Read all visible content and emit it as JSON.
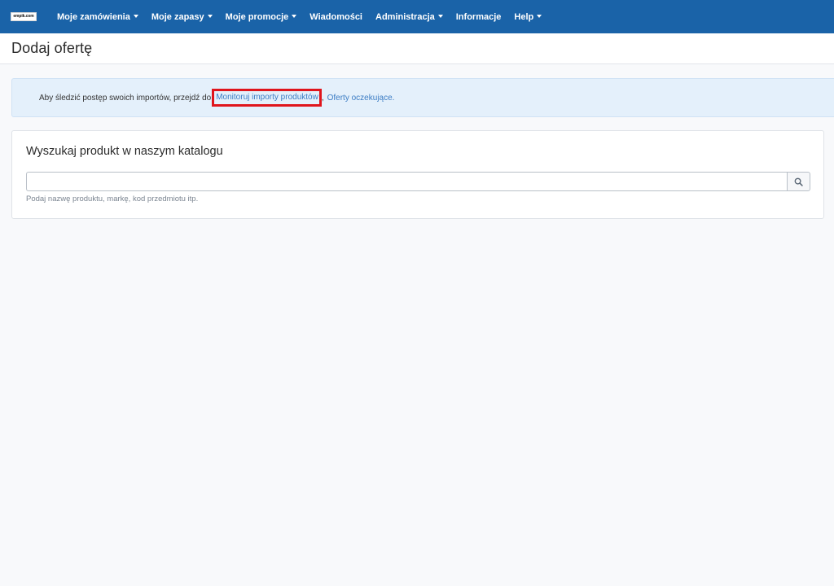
{
  "brand": {
    "logo_text": "empik.com"
  },
  "nav": {
    "items": [
      {
        "label": "Moje zamówienia",
        "dropdown": true
      },
      {
        "label": "Moje zapasy",
        "dropdown": true
      },
      {
        "label": "Moje promocje",
        "dropdown": true
      },
      {
        "label": "Wiadomości",
        "dropdown": false
      },
      {
        "label": "Administracja",
        "dropdown": true
      },
      {
        "label": "Informacje",
        "dropdown": false
      },
      {
        "label": "Help",
        "dropdown": true
      }
    ]
  },
  "page": {
    "title": "Dodaj ofertę"
  },
  "alert": {
    "text": "Aby śledzić postęp swoich importów, przejdź do",
    "link_monitor": "Monitoruj importy produktów",
    "separator": ",",
    "link_pending": "Oferty oczekujące."
  },
  "search": {
    "title": "Wyszukaj produkt w naszym katalogu",
    "input_value": "",
    "input_placeholder": "",
    "help_text": "Podaj nazwę produktu, markę, kod przedmiotu itp.",
    "button_icon": "search-icon"
  },
  "colors": {
    "topbar": "#1a63a8",
    "link": "#3b7cc4",
    "highlight": "#e0151c",
    "alert_bg": "#e4f0fb"
  }
}
